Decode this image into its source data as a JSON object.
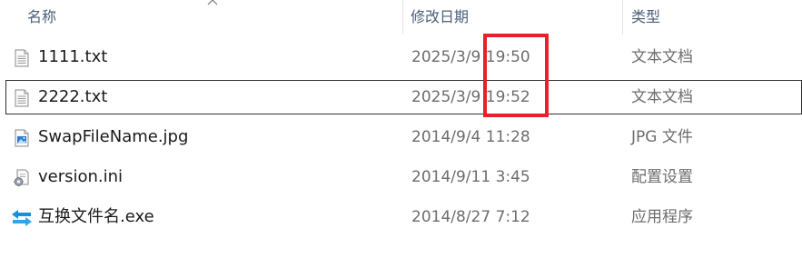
{
  "header": {
    "name_label": "名称",
    "date_label": "修改日期",
    "type_label": "类型"
  },
  "files": [
    {
      "name": "1111.txt",
      "date": "2025/3/9 19:50",
      "type": "文本文档",
      "icon": "text-document-icon"
    },
    {
      "name": "2222.txt",
      "date": "2025/3/9 19:52",
      "type": "文本文档",
      "icon": "text-document-icon"
    },
    {
      "name": "SwapFileName.jpg",
      "date": "2014/9/4 11:28",
      "type": "JPG 文件",
      "icon": "image-file-icon"
    },
    {
      "name": "version.ini",
      "date": "2014/9/11 3:45",
      "type": "配置设置",
      "icon": "settings-file-icon"
    },
    {
      "name": "互换文件名.exe",
      "date": "2014/8/27 7:12",
      "type": "应用程序",
      "icon": "swap-arrows-icon"
    }
  ],
  "colors": {
    "highlight": "#e8202a",
    "header_text": "#4c607a",
    "secondary_text": "#6d6d6d"
  }
}
